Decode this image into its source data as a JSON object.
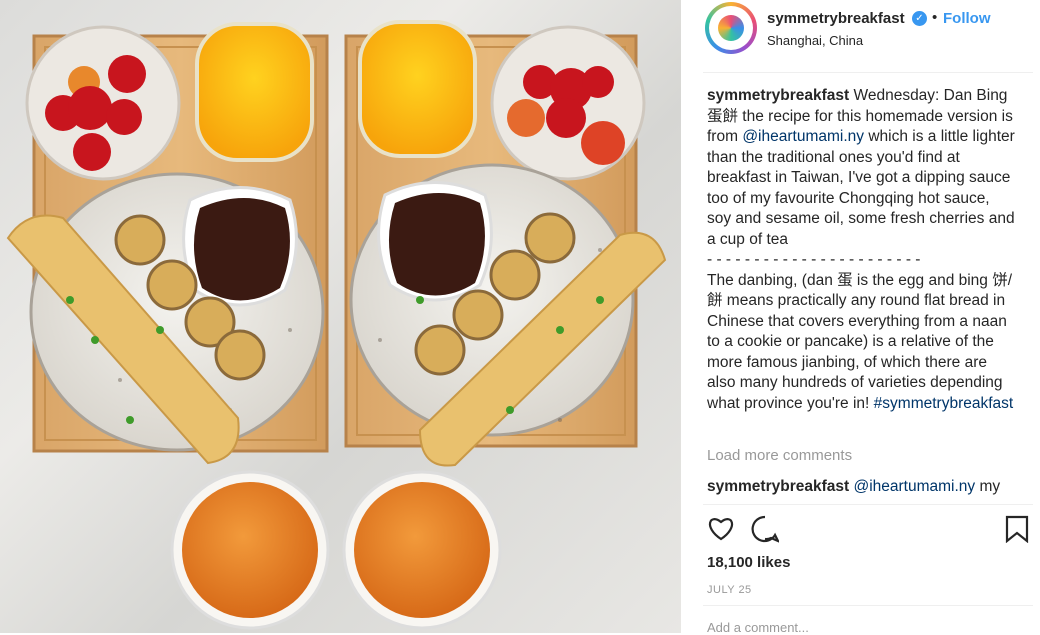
{
  "post": {
    "username": "symmetrybreakfast",
    "follow_label": "Follow",
    "dot": "•",
    "location": "Shanghai, China",
    "verified_glyph": "✓"
  },
  "caption": {
    "username": "symmetrybreakfast",
    "part1": "Wednesday: Dan Bing 蛋餅 the recipe for this homemade version is from",
    "mention": "@iheartumami.ny",
    "part2": "which is a little lighter than the traditional ones you'd find at breakfast in Taiwan, I've got a dipping sauce too of my favourite Chongqing hot sauce, soy and sesame oil, some fresh cherries and a cup of tea",
    "separator": "- - - - - - - - - - - - - - - - - - - - - - -",
    "part3": "The danbing, (dan 蛋 is the egg and bing 饼/餅 means practically any round flat bread in Chinese that covers everything from a naan to a cookie or pancake) is a relative of the more famous jianbing, of which there are also many hundreds of varieties depending what province you're in!",
    "hashtag": "#symmetrybreakfast"
  },
  "comments": {
    "load_more": "Load more comments",
    "first_user": "symmetrybreakfast",
    "first_mention": "@iheartumami.ny",
    "first_text": "my"
  },
  "stats": {
    "likes": "18,100 likes",
    "date": "JULY 25"
  },
  "add_comment_placeholder": "Add a comment...",
  "colors": {
    "accent": "#3897f0",
    "link": "#003569",
    "muted": "#999999"
  }
}
